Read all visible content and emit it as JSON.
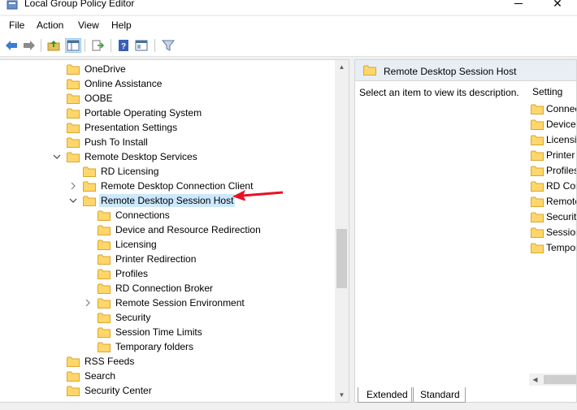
{
  "window": {
    "title": "Local Group Policy Editor"
  },
  "menu": {
    "items": [
      "File",
      "Action",
      "View",
      "Help"
    ]
  },
  "toolbar": {
    "buttons": [
      "back-icon",
      "forward-icon",
      "up-folder-icon",
      "show-hide-tree-icon",
      "export-list-icon",
      "help-icon",
      "properties-icon",
      "filter-icon"
    ]
  },
  "tree": {
    "items": [
      {
        "label": "OneDrive",
        "level": 0,
        "expander": "none"
      },
      {
        "label": "Online Assistance",
        "level": 0,
        "expander": "none"
      },
      {
        "label": "OOBE",
        "level": 0,
        "expander": "none"
      },
      {
        "label": "Portable Operating System",
        "level": 0,
        "expander": "none"
      },
      {
        "label": "Presentation Settings",
        "level": 0,
        "expander": "none"
      },
      {
        "label": "Push To Install",
        "level": 0,
        "expander": "none"
      },
      {
        "label": "Remote Desktop Services",
        "level": 0,
        "expander": "expanded"
      },
      {
        "label": "RD Licensing",
        "level": 1,
        "expander": "none"
      },
      {
        "label": "Remote Desktop Connection Client",
        "level": 1,
        "expander": "collapsed"
      },
      {
        "label": "Remote Desktop Session Host",
        "level": 1,
        "expander": "expanded",
        "selected": true
      },
      {
        "label": "Connections",
        "level": 2,
        "expander": "none"
      },
      {
        "label": "Device and Resource Redirection",
        "level": 2,
        "expander": "none"
      },
      {
        "label": "Licensing",
        "level": 2,
        "expander": "none"
      },
      {
        "label": "Printer Redirection",
        "level": 2,
        "expander": "none"
      },
      {
        "label": "Profiles",
        "level": 2,
        "expander": "none"
      },
      {
        "label": "RD Connection Broker",
        "level": 2,
        "expander": "none"
      },
      {
        "label": "Remote Session Environment",
        "level": 2,
        "expander": "collapsed"
      },
      {
        "label": "Security",
        "level": 2,
        "expander": "none"
      },
      {
        "label": "Session Time Limits",
        "level": 2,
        "expander": "none"
      },
      {
        "label": "Temporary folders",
        "level": 2,
        "expander": "none"
      },
      {
        "label": "RSS Feeds",
        "level": 0,
        "expander": "none"
      },
      {
        "label": "Search",
        "level": 0,
        "expander": "none"
      },
      {
        "label": "Security Center",
        "level": 0,
        "expander": "none"
      }
    ]
  },
  "right_pane": {
    "title": "Remote Desktop Session Host",
    "description": "Select an item to view its description.",
    "column_header": "Setting",
    "settings": [
      "Connec",
      "Device",
      "Licensi",
      "Printer",
      "Profiles",
      "RD Con",
      "Remote",
      "Security",
      "Session",
      "Tempor"
    ]
  },
  "tabs": {
    "extended": "Extended",
    "standard": "Standard"
  },
  "colors": {
    "selection": "#cce8ff",
    "folder": "#ffd66b",
    "arrow": "#e81123"
  }
}
